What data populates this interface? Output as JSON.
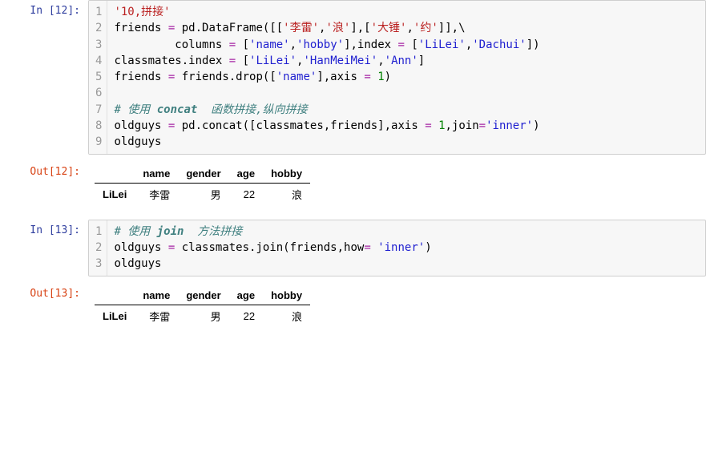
{
  "cell1": {
    "in_prompt": "In [12]:",
    "out_prompt": "Out[12]:",
    "gutter": [
      "1",
      "2",
      "3",
      "4",
      "5",
      "6",
      "7",
      "8",
      "9"
    ],
    "l1_s": "'10,拼接'",
    "l2_a": "friends ",
    "l2_op1": "=",
    "l2_b": " pd.DataFrame([[",
    "l2_s1": "'李雷'",
    "l2_c": ",",
    "l2_s2": "'浪'",
    "l2_d": "],[",
    "l2_s3": "'大锤'",
    "l2_e": ",",
    "l2_s4": "'约'",
    "l2_f": "]],\\",
    "l3_a": "         columns ",
    "l3_op1": "=",
    "l3_b": " [",
    "l3_s1": "'name'",
    "l3_c": ",",
    "l3_s2": "'hobby'",
    "l3_d": "],index ",
    "l3_op2": "=",
    "l3_e": " [",
    "l3_s3": "'LiLei'",
    "l3_f": ",",
    "l3_s4": "'Dachui'",
    "l3_g": "])",
    "l4_a": "classmates.index ",
    "l4_op1": "=",
    "l4_b": " [",
    "l4_s1": "'LiLei'",
    "l4_c": ",",
    "l4_s2": "'HanMeiMei'",
    "l4_d": ",",
    "l4_s3": "'Ann'",
    "l4_e": "]",
    "l5_a": "friends ",
    "l5_op1": "=",
    "l5_b": " friends.drop([",
    "l5_s1": "'name'",
    "l5_c": "],axis ",
    "l5_op2": "=",
    "l5_d": " ",
    "l5_n": "1",
    "l5_e": ")",
    "l7_a": "# 使用 ",
    "l7_b": "concat",
    "l7_c": "  函数拼接,纵向拼接",
    "l8_a": "oldguys ",
    "l8_op1": "=",
    "l8_b": " pd.concat([classmates,friends],axis ",
    "l8_op2": "=",
    "l8_c": " ",
    "l8_n": "1",
    "l8_d": ",join",
    "l8_op3": "=",
    "l8_s1": "'inner'",
    "l8_e": ")",
    "l9": "oldguys",
    "table": {
      "cols": [
        "name",
        "gender",
        "age",
        "hobby"
      ],
      "rows": [
        {
          "idx": "LiLei",
          "vals": [
            "李雷",
            "男",
            "22",
            "浪"
          ]
        }
      ]
    }
  },
  "cell2": {
    "in_prompt": "In [13]:",
    "out_prompt": "Out[13]:",
    "gutter": [
      "1",
      "2",
      "3"
    ],
    "l1_a": "# 使用 ",
    "l1_b": "join",
    "l1_c": "  方法拼接",
    "l2_a": "oldguys ",
    "l2_op1": "=",
    "l2_b": " classmates.join(friends,how",
    "l2_op2": "=",
    "l2_c": " ",
    "l2_s1": "'inner'",
    "l2_d": ")",
    "l3": "oldguys",
    "table": {
      "cols": [
        "name",
        "gender",
        "age",
        "hobby"
      ],
      "rows": [
        {
          "idx": "LiLei",
          "vals": [
            "李雷",
            "男",
            "22",
            "浪"
          ]
        }
      ]
    }
  }
}
